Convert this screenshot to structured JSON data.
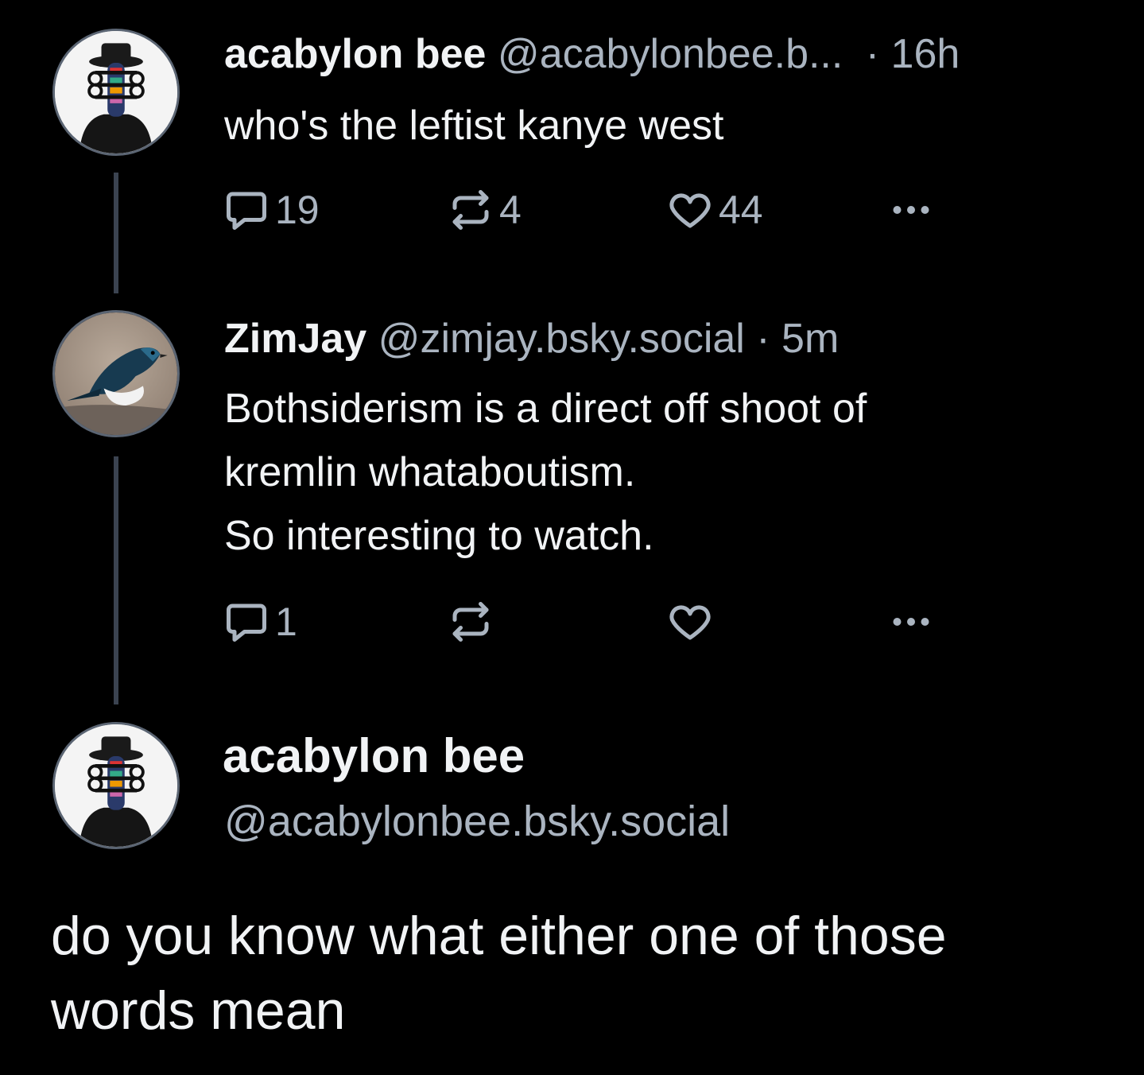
{
  "colors": {
    "background": "#000000",
    "text": "#f1f3f5",
    "muted": "#aab4c0",
    "thread_line": "#3b4350"
  },
  "posts": [
    {
      "display_name": "acabylon bee",
      "handle": "@acabylonbee.b...",
      "time": "· 16h",
      "text": [
        "who's the leftist kanye west"
      ],
      "actions": {
        "reply_icon": "reply-icon",
        "reply_count": "19",
        "repost_icon": "repost-icon",
        "repost_count": "4",
        "like_icon": "heart-icon",
        "like_count": "44",
        "more_icon": "more-icon"
      }
    },
    {
      "display_name": "ZimJay",
      "handle": "@zimjay.bsky.social",
      "time": "· 5m",
      "text": [
        "Bothsiderism is a direct off shoot of",
        "kremlin whataboutism.",
        "So interesting to watch."
      ],
      "actions": {
        "reply_icon": "reply-icon",
        "reply_count": "1",
        "repost_icon": "repost-icon",
        "repost_count": "",
        "like_icon": "heart-icon",
        "like_count": "",
        "more_icon": "more-icon"
      }
    }
  ],
  "main_post": {
    "display_name": "acabylon bee",
    "handle": "@acabylonbee.bsky.social",
    "text": [
      "do you know what either one of those",
      "words mean"
    ]
  }
}
